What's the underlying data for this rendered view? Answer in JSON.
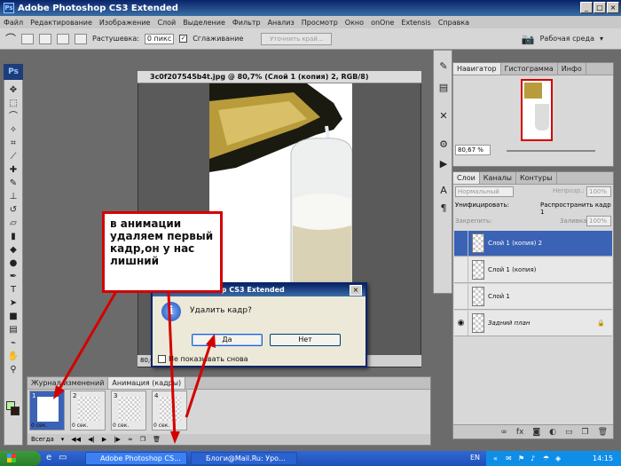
{
  "app": {
    "title": "Adobe Photoshop CS3 Extended",
    "ps_label": "Ps",
    "window_controls": [
      "_",
      "□",
      "×"
    ]
  },
  "menu": [
    "Файл",
    "Редактирование",
    "Изображение",
    "Слой",
    "Выделение",
    "Фильтр",
    "Анализ",
    "Просмотр",
    "Окно",
    "onOne",
    "Extensis",
    "Справка"
  ],
  "options": {
    "feather_label": "Растушевка:",
    "feather_value": "0 пикс",
    "antialias_label": "Сглаживание",
    "refine_edge_label": "Уточнить край...",
    "workspace_label": "Рабочая среда"
  },
  "document": {
    "title": "3c0f207545b4t.jpg @ 80,7% (Слой 1 (копия) 2, RGB/8)",
    "zoom": "80,6"
  },
  "navigator": {
    "tabs": [
      "Навигатор",
      "Гистограмма",
      "Инфо"
    ],
    "zoom": "80,67 %"
  },
  "layers": {
    "tabs": [
      "Слои",
      "Каналы",
      "Контуры"
    ],
    "blend_mode": "Нормальный",
    "opacity_label": "Непрозр.:",
    "opacity_value": "100%",
    "unify_label": "Унифицировать:",
    "propagate_label": "Распространить кадр 1",
    "lock_label": "Закрепить:",
    "fill_label": "Заливка:",
    "fill_value": "100%",
    "items": [
      {
        "name": "Слой 1 (копия) 2",
        "selected": true
      },
      {
        "name": "Слой 1 (копия)",
        "selected": false
      },
      {
        "name": "Слой 1",
        "selected": false
      },
      {
        "name": "Задний план",
        "selected": false
      }
    ]
  },
  "animation": {
    "tabs": [
      "Журнал изменений",
      "Анимация (кадры)"
    ],
    "frames": [
      {
        "num": "1",
        "time": "0 сек."
      },
      {
        "num": "2",
        "time": "0 сек."
      },
      {
        "num": "3",
        "time": "0 сек."
      },
      {
        "num": "4",
        "time": "0 сек."
      }
    ],
    "loop": "Всегда"
  },
  "dialog": {
    "title": "Adobe Photoshop CS3 Extended",
    "message": "Удалить кадр?",
    "yes": "Да",
    "no": "Нет",
    "checkbox_label": "Не показывать снова"
  },
  "annotation": {
    "text": "в анимации удаляем первый кадр,он у нас лишний"
  },
  "taskbar": {
    "tasks": [
      "Adobe Photoshop CS...",
      "Блоги@Mail.Ru: Уро..."
    ],
    "lang": "EN",
    "time": "14:15"
  },
  "colors": {
    "selection_blue": "#3a62b5",
    "annotation_red": "#d40000",
    "xp_blue": "#0a246a"
  }
}
